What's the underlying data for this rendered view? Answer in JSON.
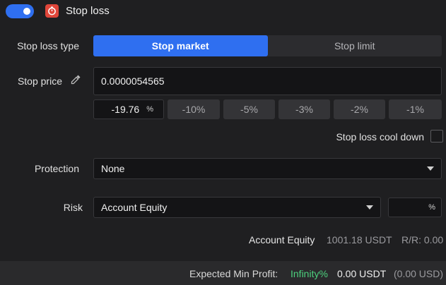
{
  "header": {
    "title": "Stop loss",
    "toggle_on": true
  },
  "stop_loss_type": {
    "label": "Stop loss type",
    "options": [
      {
        "label": "Stop market",
        "active": true
      },
      {
        "label": "Stop limit",
        "active": false
      }
    ]
  },
  "stop_price": {
    "label": "Stop price",
    "value": "0.0000054565"
  },
  "percent_input": {
    "value": "-19.76",
    "unit": "%"
  },
  "quick_percents": [
    "-10%",
    "-5%",
    "-3%",
    "-2%",
    "-1%"
  ],
  "cooldown": {
    "label": "Stop loss cool down",
    "checked": false
  },
  "protection": {
    "label": "Protection",
    "value": "None"
  },
  "risk": {
    "label": "Risk",
    "value": "Account Equity",
    "pct_unit": "%"
  },
  "summary": {
    "equity_label": "Account Equity",
    "equity_value": "1001.18 USDT",
    "rr": "R/R: 0.00"
  },
  "footer": {
    "label": "Expected Min Profit:",
    "percent": "Infinity%",
    "usdt": "0.00 USDT",
    "usd": "(0.00 USD)"
  },
  "colors": {
    "accent": "#2f6ff0",
    "stop_icon": "#e0463a",
    "profit_green": "#4cd07d"
  }
}
